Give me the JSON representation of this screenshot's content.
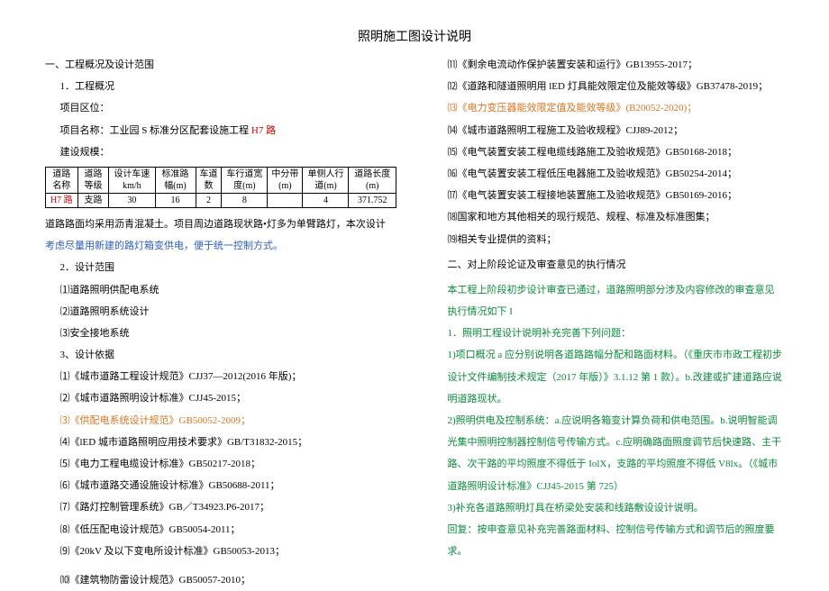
{
  "title": "照明施工图设计说明",
  "sec_a": {
    "h": "一、工程概况及设计范围",
    "s1": "1．工程概况",
    "p1": "项目区位：",
    "p2a": "项目名称：工业园 S 标准分区配套设施工程",
    "p2b": " H7 路",
    "p3": "建设规模：",
    "table": {
      "headers": [
        "道路名称",
        "道路等级",
        "设计车速km/h",
        "标准路幅(m)",
        "车道数",
        "车行道宽度(m)",
        "中分带(m)",
        "单侧人行道(m)",
        "道路长度(m)"
      ],
      "row": [
        "H7 路",
        "支路",
        "30",
        "16",
        "2",
        "8",
        "",
        "4",
        "371.752"
      ]
    },
    "p4": "道路路面均采用沥青混凝土。项目周边道路现状路•灯多为单臂路灯，本次设计",
    "p4b": "考虑尽量用新建的路灯箱变供电，便于统一控制方式。",
    "s2": "2．设计范围",
    "d1": "⑴道路照明供配电系统",
    "d2": "⑵道路照明系统设计",
    "d3": "⑶安全接地系统",
    "s3": "3、设计依据",
    "r1": "⑴《城市道路工程设计规范》CJJ37—2012(2016 年版)；",
    "r2": "⑵《城市道路照明设计标准》CJJ45-2015；",
    "r3": "⑶《供配电系统设计规范》GB50052-2009；",
    "r4": "⑷《lED 城市道路照明应用技术要求》GB/T31832-2015；",
    "r5": "⑸《电力工程电缆设计标准》GB50217-2018；",
    "r6": "⑹《城市道路交通设施设计标准》GB50688-2011；",
    "r7": "⑺《路灯控制管理系统》GB／T34923.P6-2017；",
    "r8": "⑻《低压配电设计规范》GB50054-2011；",
    "r9": "⑼《20kV 及以下变电所设计标准》GB50053-2013；",
    "r10": "⑽《建筑物防雷设计规范》GB50057-2010；"
  },
  "sec_b": {
    "r11": "⑾《剩余电流动作保护装置安装和运行》GB13955-2017；",
    "r12": "⑿《道路和隧道照明用 lED 灯具能效限定位及能效等级》GB37478-2019；",
    "r13": "⒀《电力变压器能效限定值及能效等级》(B20052-2020)；",
    "r14": "⒁《城市道路照明工程施工及验收规程》CJJ89-2012；",
    "r15": "⒂《电气装置安装工程电缆线路施工及验收规范》GB50168-2018；",
    "r16": "⒃《电气装置安装工程低压电器施工及验收规范》GB50254-2014；",
    "r17": "⒄《电气装置安装工程接地装置施工及验收规范》GB50169-2016；",
    "r18": "⒅国家和地方其他相关的现行规范、规程、标准及标准图集；",
    "r19": "⒆相关专业提供的资料；",
    "h2": "二、对上阶段论证及审查意见的执行情况",
    "p1": "本工程上阶段初步设计审查已通过，道路照明部分涉及内容修改的审查意见执行情况如下 I",
    "p2": "1．照明工程设计说明补充完善下列问题：",
    "p3": "1)项口概况 a 应分别说明各道路路幅分配和路面材料。（《重庆市市政工程初步设计文件编制技术规定（2017 年版）》3.1.12 第 1 款）。b.改建或扩建道路应说明道路现状。",
    "p4": "2)照明供电及控制系统：a.应说明各箱变计算负荷和供电范围。b.说明智能调光集中照明控制器控制信号传输方式。c.应明确路面照度调节后快速路、主干路、次干路的平均照度不得低于 IolX，支路的平均照度不得低 V8lx。（《城市道路照明设计标准》CJJ45-2015 第 725）",
    "p5": "3)补充各道路照明灯具在桥梁处安装和线路敷设设计说明。",
    "p6": "回复：按申查意见补充完善路面材料、控制信号传输方式和调节后的照度要求。"
  }
}
